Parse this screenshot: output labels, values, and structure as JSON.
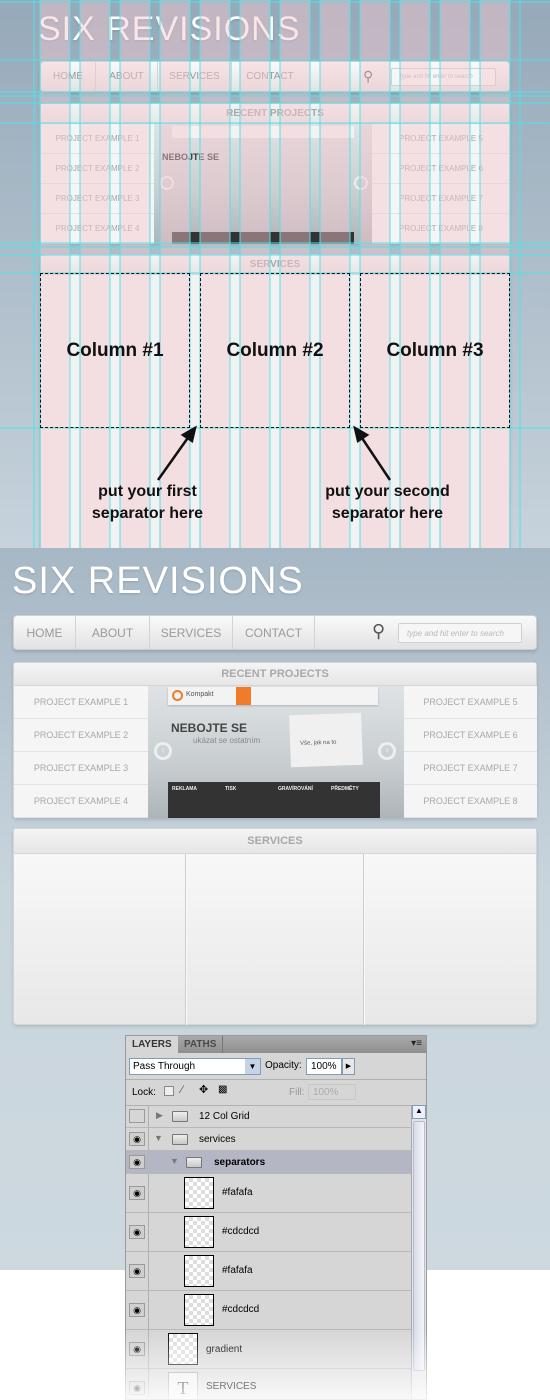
{
  "site": {
    "title": "SIX REVISIONS",
    "nav": [
      "HOME",
      "ABOUT",
      "SERVICES",
      "CONTACT"
    ],
    "search_placeholder": "type and hit enter to search",
    "recent_projects_title": "RECENT PROJECTS",
    "projects_left": [
      "PROJECT EXAMPLE 1",
      "PROJECT EXAMPLE 2",
      "PROJECT EXAMPLE 3",
      "PROJECT EXAMPLE 4"
    ],
    "projects_right": [
      "PROJECT EXAMPLE 5",
      "PROJECT EXAMPLE 6",
      "PROJECT EXAMPLE 7",
      "PROJECT EXAMPLE 8"
    ],
    "services_title": "SERVICES",
    "slide": {
      "logo": "Kompakt",
      "headline": "NEBOJTE SE",
      "subline": "ukázat se ostatním",
      "sign_text": "Vše, jak na to",
      "features": [
        "REKLAMA",
        "TISK",
        "GRAVÍROVÁNÍ",
        "PŘEDMĚTY"
      ],
      "accent": "#f07c2a"
    }
  },
  "annotation": {
    "columns": [
      "Column #1",
      "Column #2",
      "Column #3"
    ],
    "note_first": "put your first separator here",
    "note_second": "put your second separator here",
    "grid_color": "#4fe3e8",
    "overlay_color": "#f4c6cc"
  },
  "layers_panel": {
    "tabs": [
      "LAYERS",
      "PATHS"
    ],
    "blend_mode": "Pass Through",
    "opacity_label": "Opacity:",
    "opacity": "100%",
    "lock_label": "Lock:",
    "fill_label": "Fill:",
    "fill": "100%",
    "layers": [
      {
        "name": "12 Col Grid",
        "type": "group",
        "visible": false,
        "expanded": false
      },
      {
        "name": "services",
        "type": "group",
        "visible": true,
        "expanded": true
      },
      {
        "name": "separators",
        "type": "group",
        "visible": true,
        "expanded": true,
        "selected": true
      },
      {
        "name": "#fafafa",
        "type": "layer",
        "visible": true
      },
      {
        "name": "#cdcdcd",
        "type": "layer",
        "visible": true
      },
      {
        "name": "#fafafa",
        "type": "layer",
        "visible": true
      },
      {
        "name": "#cdcdcd",
        "type": "layer",
        "visible": true
      },
      {
        "name": "gradient",
        "type": "layer",
        "visible": true
      },
      {
        "name": "SERVICES",
        "type": "text",
        "visible": true
      }
    ]
  }
}
